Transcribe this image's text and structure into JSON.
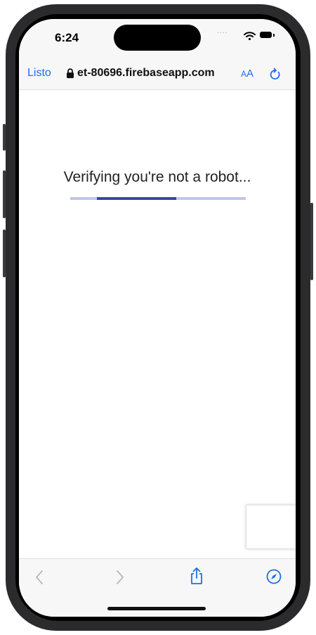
{
  "status_bar": {
    "time": "6:24",
    "signal_dots": "....",
    "wifi_icon": "wifi-icon",
    "battery_icon": "battery-icon"
  },
  "browser": {
    "done_label": "Listo",
    "url": "et-80696.firebaseapp.com",
    "lock_icon": "lock-icon",
    "text_size": {
      "small": "A",
      "large": "A"
    },
    "reload_icon": "reload-icon"
  },
  "page": {
    "heading": "Verifying you're not a robot...",
    "progress": 0.45,
    "progress_offset": 0.15
  },
  "toolbar": {
    "icons": [
      "back-icon",
      "forward-icon",
      "share-icon",
      "compass-icon"
    ]
  },
  "colors": {
    "accent": "#1e6fe6",
    "progress_track": "#c1c6e8",
    "progress_fill": "#3a45a5"
  }
}
